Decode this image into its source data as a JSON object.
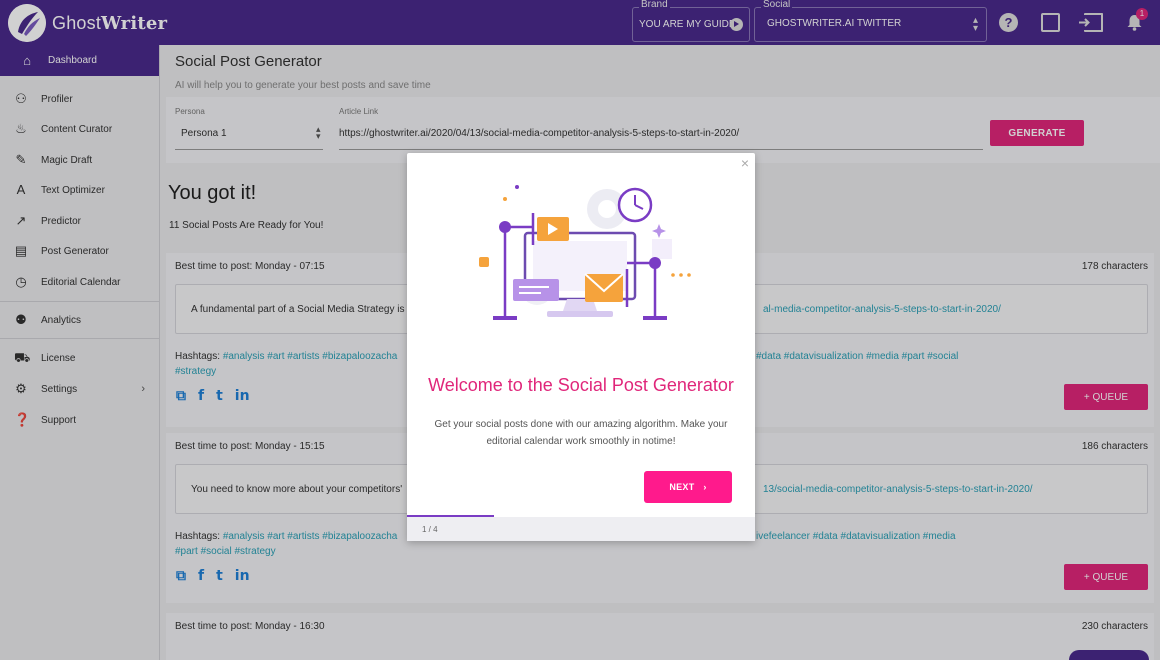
{
  "app": {
    "name_light": "Ghost",
    "name_bold": "Writer"
  },
  "topbar": {
    "brand_label": "Brand",
    "brand_value": "YOU ARE MY GUIDE",
    "social_label": "Social",
    "social_value": "GHOSTWRITER.AI TWITTER",
    "notification_count": "1"
  },
  "sidebar": {
    "items": [
      {
        "label": "Dashboard",
        "icon": "home-icon"
      },
      {
        "label": "Profiler",
        "icon": "people-icon"
      },
      {
        "label": "Content Curator",
        "icon": "fire-icon"
      },
      {
        "label": "Magic Draft",
        "icon": "pen-icon"
      },
      {
        "label": "Text Optimizer",
        "icon": "spellcheck-icon"
      },
      {
        "label": "Predictor",
        "icon": "trend-icon"
      },
      {
        "label": "Post Generator",
        "icon": "document-icon"
      },
      {
        "label": "Editorial Calendar",
        "icon": "clock-icon"
      },
      {
        "label": "Analytics",
        "icon": "group-icon"
      },
      {
        "label": "License",
        "icon": "cart-icon"
      },
      {
        "label": "Settings",
        "icon": "gear-icon"
      },
      {
        "label": "Support",
        "icon": "help-icon"
      }
    ]
  },
  "page": {
    "title": "Social Post Generator",
    "subtitle": "AI will help you to generate your best posts and save time",
    "persona_label": "Persona",
    "persona_value": "Persona 1",
    "article_label": "Article Link",
    "article_value": "https://ghostwriter.ai/2020/04/13/social-media-competitor-analysis-5-steps-to-start-in-2020/",
    "generate_label": "GENERATE",
    "headline": "You got it!",
    "ready_text": "11 Social Posts Are Ready for You!"
  },
  "posts": [
    {
      "time": "Best time to post: Monday - 07:15",
      "chars": "178 characters",
      "text": "A fundamental part of a Social Media Strategy is",
      "link": "al-media-competitor-analysis-5-steps-to-start-in-2020/",
      "hashtags_label": "Hashtags:",
      "hashtags_left": "#analysis #art #artists #bizapaloozacha",
      "hashtags_right": "#data #datavisualization #media #part #social",
      "hashtags_line2": "#strategy",
      "queue_label": "+ QUEUE"
    },
    {
      "time": "Best time to post: Monday - 15:15",
      "chars": "186 characters",
      "text": "You need to know more about your competitors'",
      "link": "13/social-media-competitor-analysis-5-steps-to-start-in-2020/",
      "hashtags_label": "Hashtags:",
      "hashtags_left": "#analysis #art #artists #bizapaloozacha",
      "hashtags_right": "ivefeelancer #data #datavisualization #media",
      "hashtags_line2": "#part #social #strategy",
      "queue_label": "+ QUEUE"
    },
    {
      "time": "Best time to post: Monday - 16:30",
      "chars": "230 characters"
    }
  ],
  "share": {
    "copy": "⧉",
    "facebook": "f",
    "twitter": "t",
    "linkedin": "in"
  },
  "modal": {
    "close": "×",
    "title": "Welcome to the Social Post Generator",
    "description": "Get your social posts done with our amazing algorithm. Make your editorial calendar work smoothly in notime!",
    "next_label": "NEXT",
    "step": "1 / 4",
    "progress": 0.25
  },
  "colors": {
    "primary": "#4a2a8c",
    "accent": "#e0267a",
    "link": "#2a9fb5"
  }
}
